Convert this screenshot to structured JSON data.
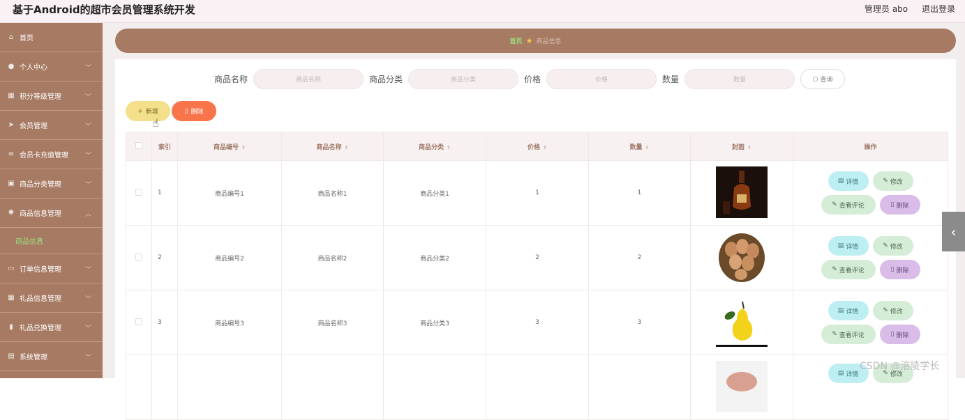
{
  "app": {
    "title": "基于Android的超市会员管理系统开发",
    "user_label": "管理员 abo",
    "logout_label": "退出登录"
  },
  "sidebar": {
    "items": [
      {
        "label": "首页",
        "icon": "home-icon"
      },
      {
        "label": "个人中心",
        "icon": "user-icon"
      },
      {
        "label": "积分等级管理",
        "icon": "grid-icon"
      },
      {
        "label": "会员管理",
        "icon": "send-icon"
      },
      {
        "label": "会员卡充值管理",
        "icon": "list-icon"
      },
      {
        "label": "商品分类管理",
        "icon": "calendar-icon"
      },
      {
        "label": "商品信息管理",
        "icon": "tag-icon"
      }
    ],
    "active_sub": "商品信息",
    "items_after": [
      {
        "label": "订单信息管理",
        "icon": "card-icon"
      },
      {
        "label": "礼品信息管理",
        "icon": "grid-icon"
      },
      {
        "label": "礼品兑换管理",
        "icon": "bar-icon"
      },
      {
        "label": "系统管理",
        "icon": "settings-icon"
      }
    ]
  },
  "breadcrumb": {
    "home": "首页",
    "current": "商品信息"
  },
  "search": {
    "fields": [
      {
        "label": "商品名称",
        "placeholder": "商品名称"
      },
      {
        "label": "商品分类",
        "placeholder": "商品分类"
      },
      {
        "label": "价格",
        "placeholder": "价格"
      },
      {
        "label": "数量",
        "placeholder": "数量"
      }
    ],
    "button_label": "查询"
  },
  "toolbar": {
    "add_label": "新增",
    "delete_label": "删除"
  },
  "table": {
    "headers": [
      "索引",
      "商品编号",
      "商品名称",
      "商品分类",
      "价格",
      "数量",
      "封面",
      "操作"
    ],
    "rows": [
      {
        "index": "1",
        "code": "商品编号1",
        "name": "商品名称1",
        "category": "商品分类1",
        "price": "1",
        "qty": "1",
        "cover": "cognac-bottle"
      },
      {
        "index": "2",
        "code": "商品编号2",
        "name": "商品名称2",
        "category": "商品分类2",
        "price": "2",
        "qty": "2",
        "cover": "egg-basket"
      },
      {
        "index": "3",
        "code": "商品编号3",
        "name": "商品名称3",
        "category": "商品分类3",
        "price": "3",
        "qty": "3",
        "cover": "pear"
      }
    ],
    "actions": {
      "detail": "详情",
      "edit": "修改",
      "review": "查看评论",
      "delete": "删除"
    }
  },
  "watermark": "CSDN @涪陵学长"
}
